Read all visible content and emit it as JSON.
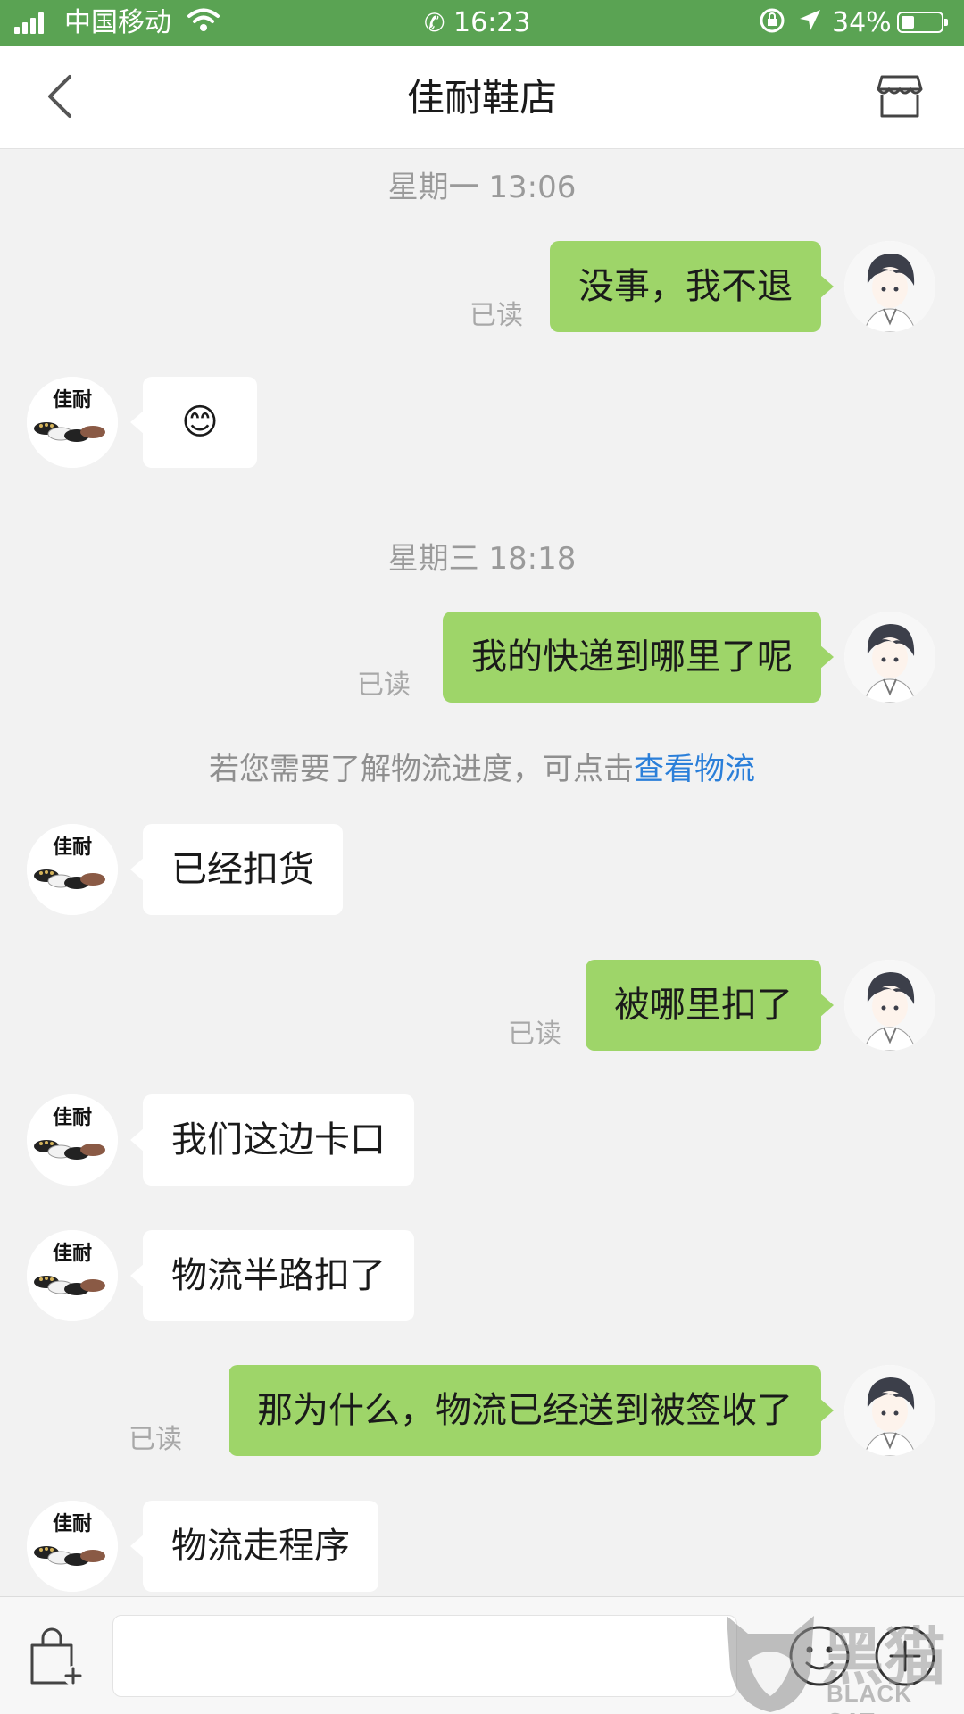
{
  "status_bar": {
    "carrier": "中国移动",
    "time": "16:23",
    "battery": "34%",
    "battery_level": 0.34
  },
  "nav": {
    "title": "佳耐鞋店",
    "back_icon": "chevron-left-icon",
    "store_icon": "store-icon"
  },
  "shop_avatar_label": "佳耐",
  "chat": {
    "time_1": "星期一 13:06",
    "time_2": "星期三 18:18",
    "read_label": "已读",
    "msg_1": "没事，我不退",
    "msg_2_emoji": "😊",
    "msg_3": "我的快递到哪里了呢",
    "system_note": "若您需要了解物流进度，可点击",
    "system_link": "查看物流",
    "msg_4": "已经扣货",
    "msg_5": "被哪里扣了",
    "msg_6": "我们这边卡口",
    "msg_7": "物流半路扣了",
    "msg_8": "那为什么，物流已经送到被签收了",
    "msg_9": "物流走程序"
  },
  "input_bar": {
    "placeholder": "",
    "bag_icon": "shopping-bag-add-icon",
    "emoji_icon": "emoji-icon",
    "plus_icon": "plus-icon"
  },
  "watermark": {
    "cn": "黑猫",
    "en": "BLACK CAT"
  },
  "colors": {
    "status_bar_bg": "#5aa353",
    "sent_bubble": "#9ed569",
    "recv_bubble": "#ffffff",
    "link": "#2b7fd9"
  }
}
